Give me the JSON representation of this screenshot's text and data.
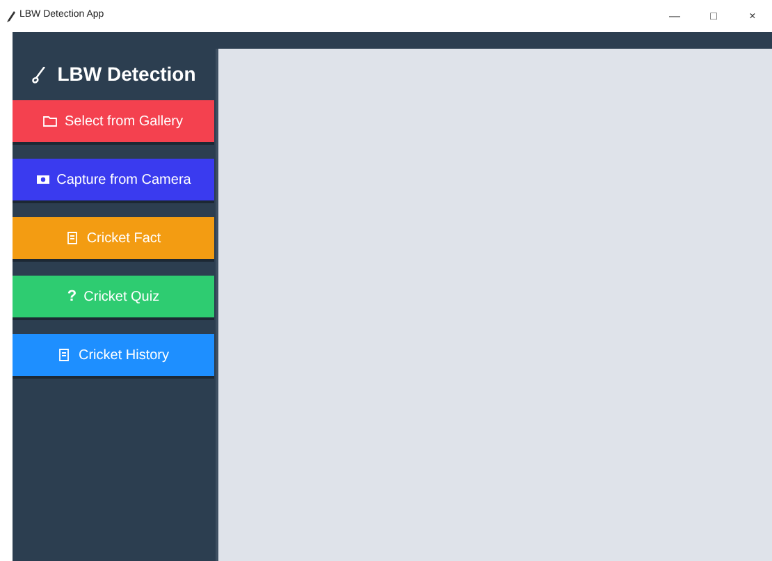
{
  "window": {
    "title": "LBW Detection App",
    "controls": [
      "—",
      "□",
      "×"
    ]
  },
  "sidebar": {
    "title": "LBW Detection",
    "buttons": [
      {
        "label": "Select from Gallery",
        "kind": "folder",
        "color": "#f4414f"
      },
      {
        "label": "Capture from Camera",
        "kind": "camera",
        "color": "#3a3bef"
      },
      {
        "label": "Cricket Fact",
        "kind": "scroll",
        "color": "#f39c12"
      },
      {
        "label": "Cricket Quiz",
        "kind": "glyph",
        "glyph": "?",
        "color": "#2ecc71"
      },
      {
        "label": "Cricket History",
        "kind": "scroll",
        "color": "#1e8fff"
      }
    ]
  }
}
